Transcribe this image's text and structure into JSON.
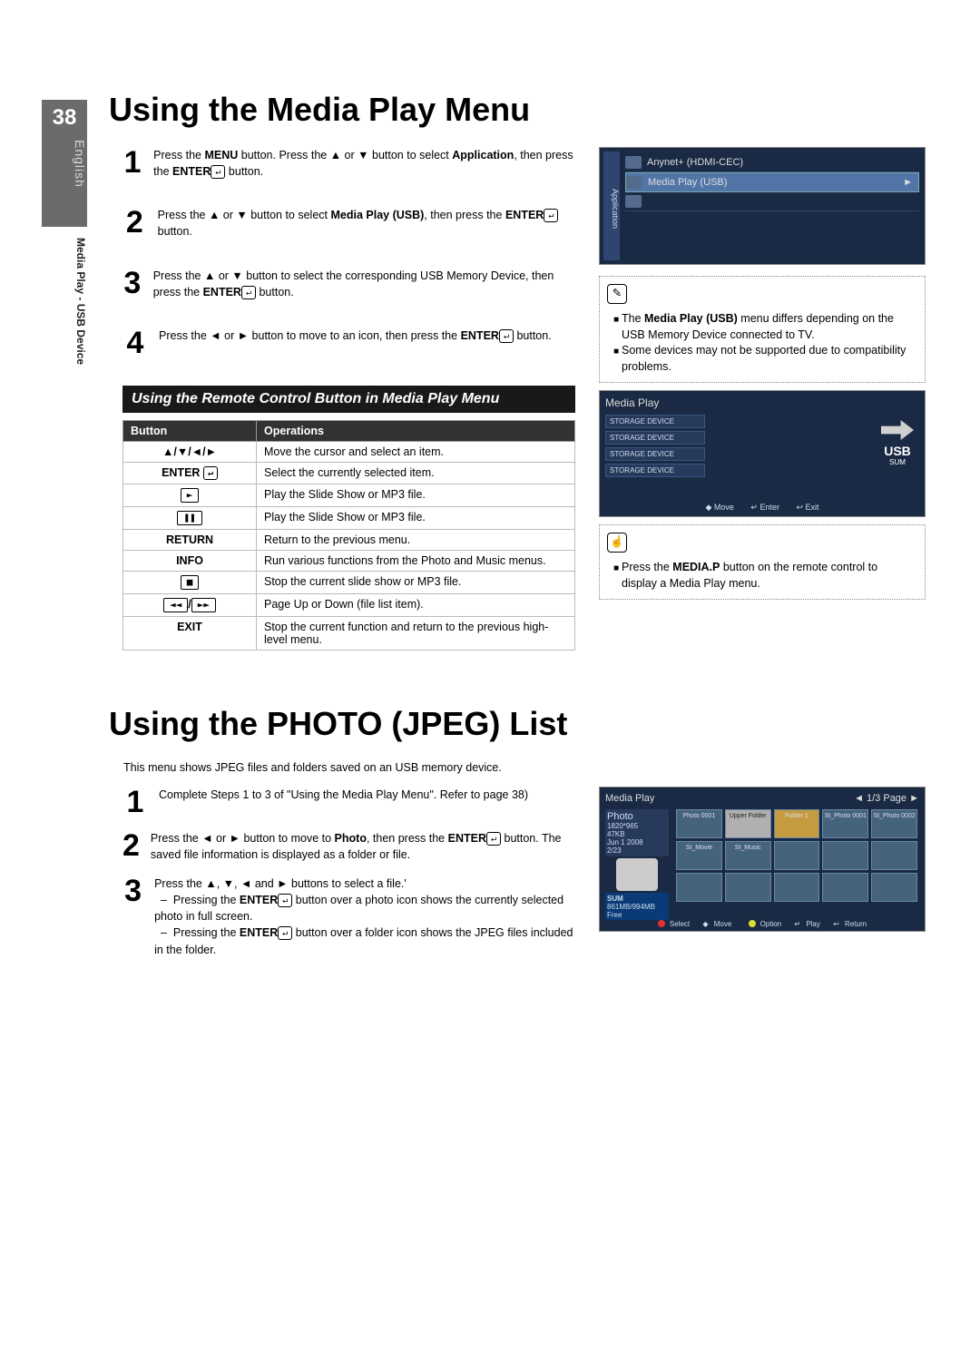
{
  "page_number": "38",
  "language": "English",
  "section_label": "Media Play - USB Device",
  "title1": "Using the Media Play Menu",
  "steps1": [
    {
      "n": "1",
      "html": "Press the <b>MENU</b> button. Press the ▲ or ▼ button to select <b>Application</b>, then press the <b>ENTER</b><span class='enter-glyph'>↵</span> button."
    },
    {
      "n": "2",
      "html": "Press the ▲ or ▼ button to select <b>Media Play (USB)</b>, then press the <b>ENTER</b><span class='enter-glyph'>↵</span> button."
    },
    {
      "n": "3",
      "html": "Press the ▲ or ▼ button to select the corresponding USB Memory Device, then press the <b>ENTER</b><span class='enter-glyph'>↵</span> button."
    },
    {
      "n": "4",
      "html": "Press the ◄ or ► button to move to an icon, then press the <b>ENTER</b><span class='enter-glyph'>↵</span> button."
    }
  ],
  "banner1": "Using the Remote Control Button in Media Play Menu",
  "ops_headers": [
    "Button",
    "Operations"
  ],
  "ops_rows": [
    {
      "btn": "▲/▼/◄/►",
      "op": "Move the cursor and select an item."
    },
    {
      "btn": "ENTER <span class='enter-glyph'>↵</span>",
      "op": "Select the currently selected item."
    },
    {
      "btn": "<span class='iconbox'>►</span>",
      "op": "Play the Slide Show or MP3 file."
    },
    {
      "btn": "<span class='iconbox'>❚❚</span>",
      "op": "Play the Slide Show or MP3 file."
    },
    {
      "btn": "RETURN",
      "op": "Return to the previous menu."
    },
    {
      "btn": "INFO",
      "op": "Run various functions from the Photo and Music menus."
    },
    {
      "btn": "<span class='iconbox'>■</span>",
      "op": "Stop the current slide show or MP3 file."
    },
    {
      "btn": "<span class='iconbox'>◄◄</span>/<span class='iconbox'>►►</span>",
      "op": "Page Up or Down (file list item)."
    },
    {
      "btn": "EXIT",
      "op": "Stop the current function and return to the previous high-level menu."
    }
  ],
  "ss1": {
    "tab": "Application",
    "row1": "Anynet+ (HDMI-CEC)",
    "row2": "Media Play (USB)"
  },
  "note1_items": [
    "The <b>Media Play (USB)</b> menu differs depending on the USB Memory Device connected to TV.",
    "Some devices may not be supported due to compatibility problems."
  ],
  "ss2": {
    "title": "Media Play",
    "device": "STORAGE DEVICE",
    "usb_label": "USB",
    "usb_sub": "SUM",
    "foot_move": "◆ Move",
    "foot_enter": "↵ Enter",
    "foot_exit": "↩ Exit"
  },
  "note2_items": [
    "Press the <b>MEDIA.P</b> button on the remote control to display a Media Play menu."
  ],
  "title2": "Using the PHOTO (JPEG) List",
  "intro2": "This menu shows JPEG files and folders saved on an USB memory device.",
  "steps2": [
    {
      "n": "1",
      "html": "Complete Steps 1 to 3 of \"Using the Media Play Menu\". Refer to page 38)"
    },
    {
      "n": "2",
      "html": "Press the ◄ or ► button to move to <b>Photo</b>, then press the <b>ENTER</b><span class='enter-glyph'>↵</span> button. The saved file information is displayed as a folder or file."
    },
    {
      "n": "3",
      "html": "Press the ▲, ▼, ◄ and ► buttons to select a file.'<br>&nbsp;&nbsp;–&nbsp;&nbsp;Pressing the <b>ENTER</b><span class='enter-glyph'>↵</span> button over a photo icon shows the currently selected photo in full screen.<br>&nbsp;&nbsp;–&nbsp;&nbsp;Pressing the <b>ENTER</b><span class='enter-glyph'>↵</span> button over a folder icon shows the JPEG files included in the folder."
    }
  ],
  "ss3": {
    "title": "Media Play",
    "crumb": "◄  1/3 Page  ►",
    "panel_title": "Photo",
    "panel_lines": [
      "1820*965",
      "47KB",
      "Jun 1 2008",
      "2/23"
    ],
    "sum_title": "SUM",
    "sum_line": "861MB/994MB Free",
    "thumbs": [
      "Photo 0001",
      "Upper Folder",
      "Folder 1",
      "St_Photo 0001",
      "St_Photo 0002",
      "St_Movie",
      "St_Music",
      "",
      "",
      "",
      "",
      "",
      "",
      "",
      ""
    ],
    "foot": [
      "Select",
      "Move",
      "Option",
      "Play",
      "Return"
    ]
  }
}
